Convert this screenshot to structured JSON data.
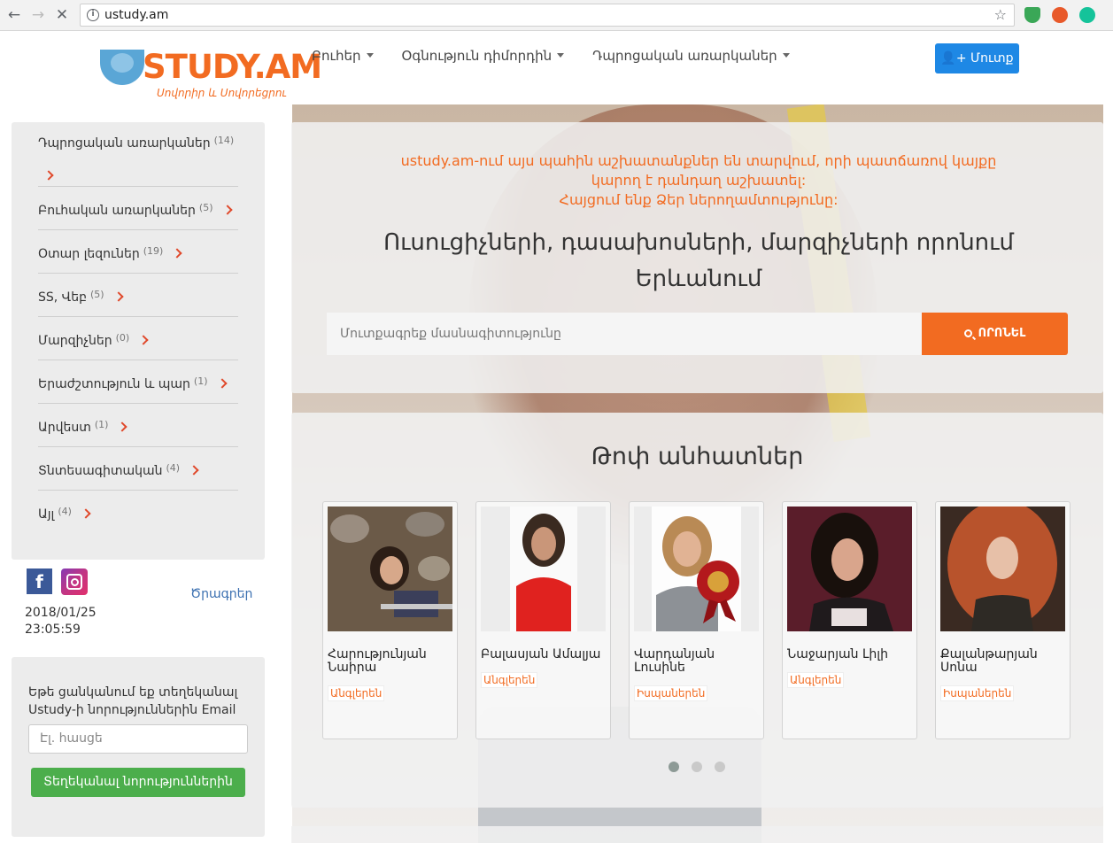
{
  "browser": {
    "url": "ustudy.am"
  },
  "header": {
    "logo_text": "STUDY.AM",
    "logo_tagline": "Սովորիր և Սովորեցրու",
    "nav": [
      {
        "label": "Բուհեր"
      },
      {
        "label": "Օգնություն դիմորդին"
      },
      {
        "label": "Դպրոցական առարկաներ"
      }
    ],
    "login_label": "Մուտք"
  },
  "sidebar": {
    "categories": [
      {
        "label": "Դպրոցական առարկաներ",
        "count": "(14)"
      },
      {
        "label": "Բուհական առարկաներ",
        "count": "(5)"
      },
      {
        "label": "Օտար լեզուներ",
        "count": "(19)"
      },
      {
        "label": "SS, Վեբ",
        "count": "(5)"
      },
      {
        "label": "Մարզիչներ",
        "count": "(0)"
      },
      {
        "label": "Երաժշտություն և պար",
        "count": "(1)"
      },
      {
        "label": "Արվեստ",
        "count": "(1)"
      },
      {
        "label": "Տնտեսագիտական",
        "count": "(4)"
      },
      {
        "label": "Այլ",
        "count": "(4)"
      }
    ],
    "programs_link": "Ծրագրեր",
    "date": "2018/01/25",
    "time": "23:05:59"
  },
  "subscribe": {
    "text": "Եթե ցանկանում եք տեղեկանալ Ustudy-ի նորություններին Email",
    "email_placeholder": "Էլ. հասցե",
    "button_label": "Տեղեկանալ նորություններին"
  },
  "search": {
    "notice_line1": "ustudy.am-ում այս պահին աշխատանքներ են տարվում, որի պատճառով կայքը",
    "notice_line2": "կարող է դանդաղ աշխատել:",
    "notice_line3": "Հայցում ենք Ձեր ներողամտությունը:",
    "headline_line1": "Ուսուցիչների, դասախոսների, մարզիչների որոնում",
    "headline_line2": "Երևանում",
    "placeholder": "Մուտքագրեք մասնագիտությունը",
    "button_label": "ՈՐՈՆԵԼ"
  },
  "profiles": {
    "title": "Թոփ անհատներ",
    "cards": [
      {
        "name": "Հարությունյան Նաիրա",
        "tag": "Անգլերեն"
      },
      {
        "name": "Բալասյան Ամալյա",
        "tag": "Անգլերեն"
      },
      {
        "name": "Վարդանյան Լուսինե",
        "tag": "Իսպաներեն"
      },
      {
        "name": "Նաջարյան Լիլի",
        "tag": "Անգլերեն"
      },
      {
        "name": "Քալանթարյան Սոնա",
        "tag": "Իսպաներեն"
      }
    ]
  },
  "colors": {
    "brand_orange": "#f26b21",
    "login_blue": "#1e88e5",
    "subscribe_green": "#4cae4c"
  }
}
